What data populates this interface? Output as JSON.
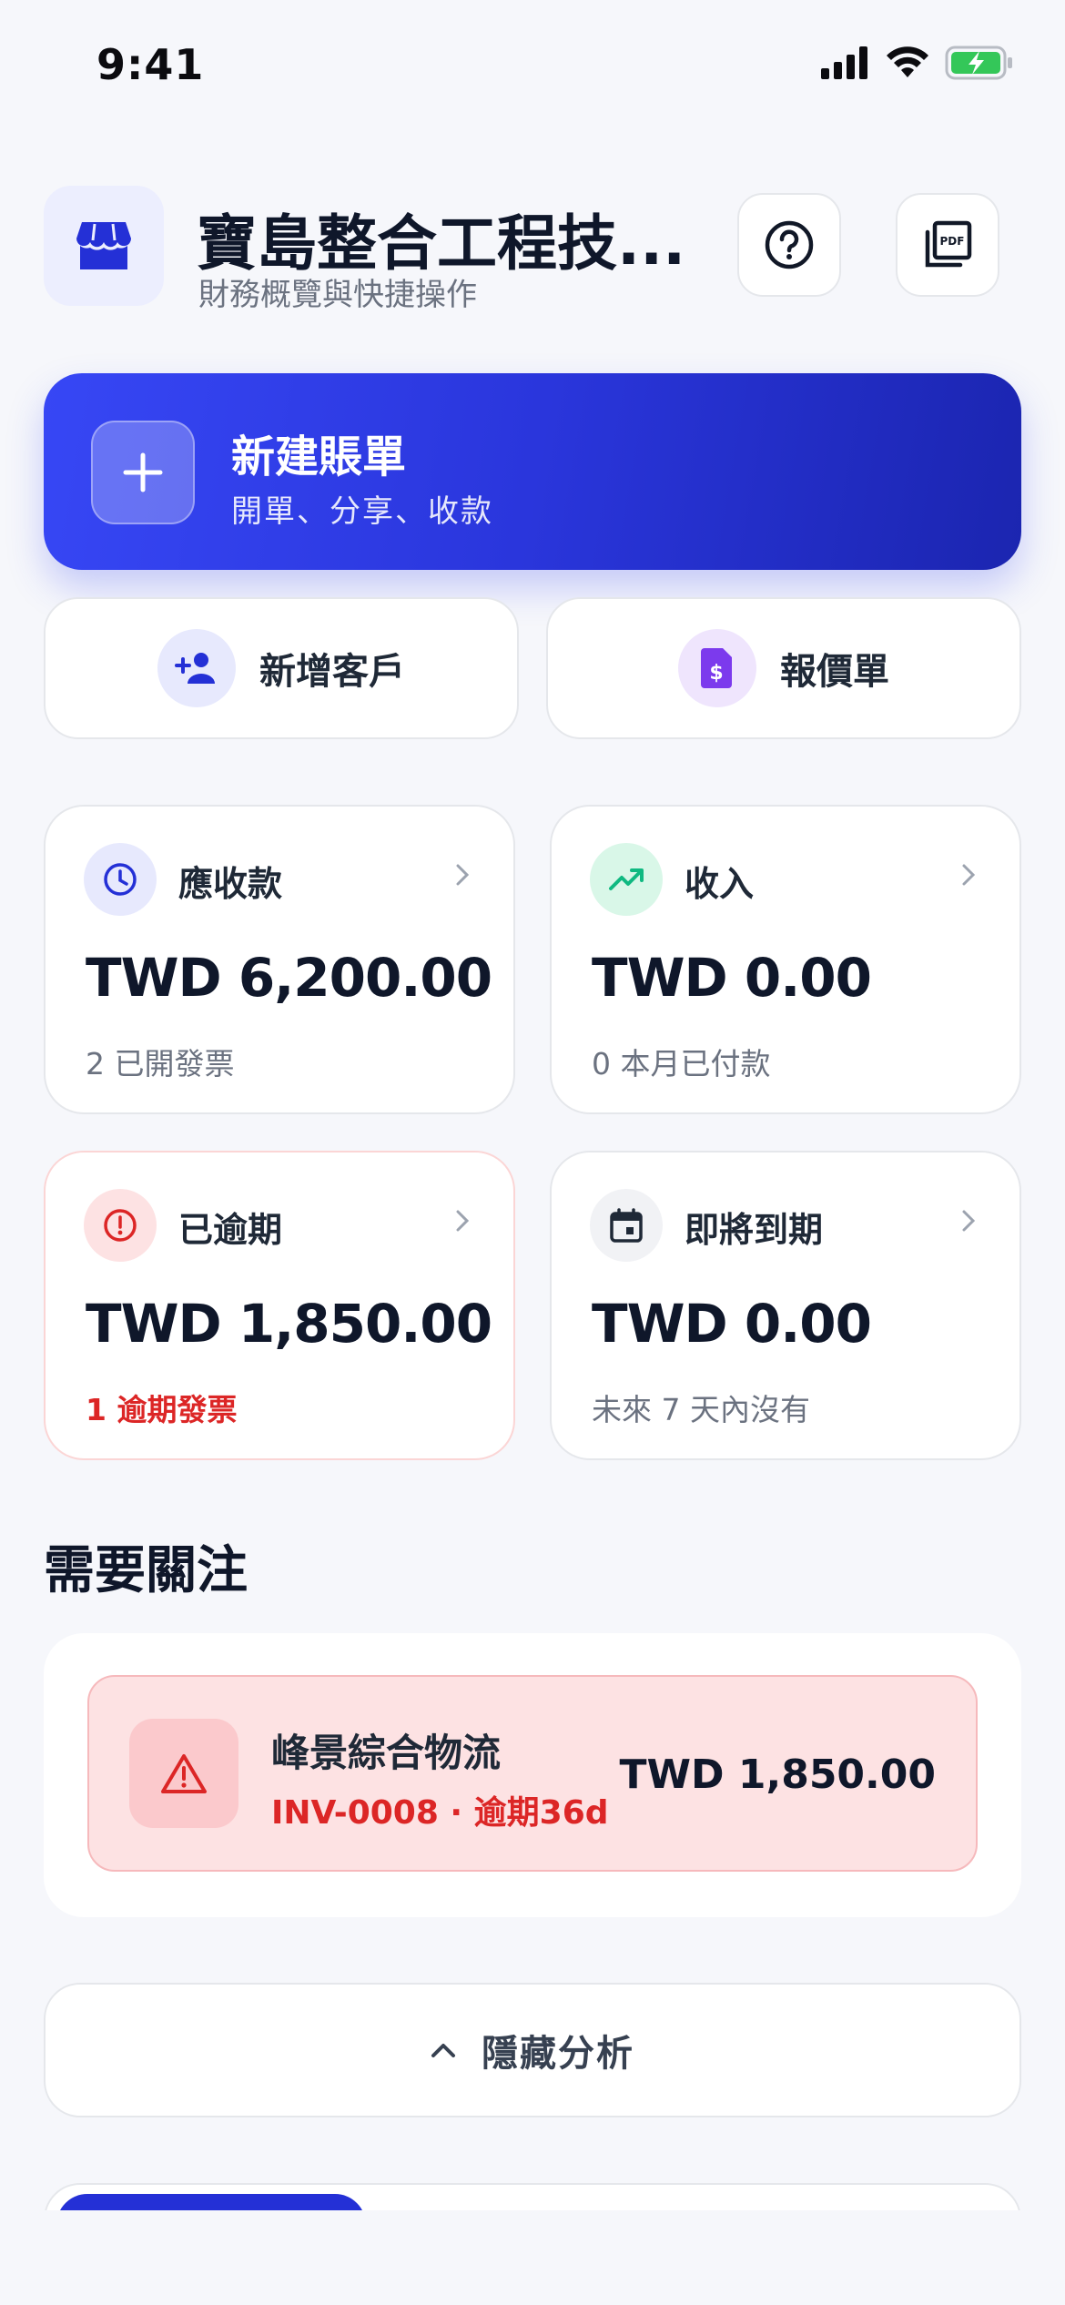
{
  "status_bar": {
    "time": "9:41"
  },
  "header": {
    "company_name": "寶島整合工程技...",
    "subtitle": "財務概覽與快捷操作"
  },
  "primary_action": {
    "title": "新建賬單",
    "subtitle": "開單、分享、收款"
  },
  "secondary_actions": [
    {
      "label": "新增客戶",
      "icon": "add-user-icon"
    },
    {
      "label": "報價單",
      "icon": "quote-document-icon"
    }
  ],
  "stats": {
    "receivable": {
      "title": "應收款",
      "value": "TWD 6,200.00",
      "note": "2 已開發票",
      "icon": "clock-icon"
    },
    "income": {
      "title": "收入",
      "value": "TWD 0.00",
      "note": "0 本月已付款",
      "icon": "trending-up-icon"
    },
    "overdue": {
      "title": "已逾期",
      "value": "TWD 1,850.00",
      "note": "1 逾期發票",
      "icon": "alert-circle-icon"
    },
    "upcoming": {
      "title": "即將到期",
      "value": "TWD 0.00",
      "note": "未來 7 天內沒有",
      "icon": "calendar-icon"
    }
  },
  "attention": {
    "title": "需要關注",
    "items": [
      {
        "name": "峰景綜合物流",
        "meta": "INV-0008 · 逾期36d",
        "amount": "TWD 1,850.00"
      }
    ]
  },
  "analysis_toggle": {
    "label": "隱藏分析"
  },
  "colors": {
    "primary": "#3747f5",
    "danger": "#dc2626",
    "success": "#10b981",
    "background": "#f6f7fb"
  }
}
